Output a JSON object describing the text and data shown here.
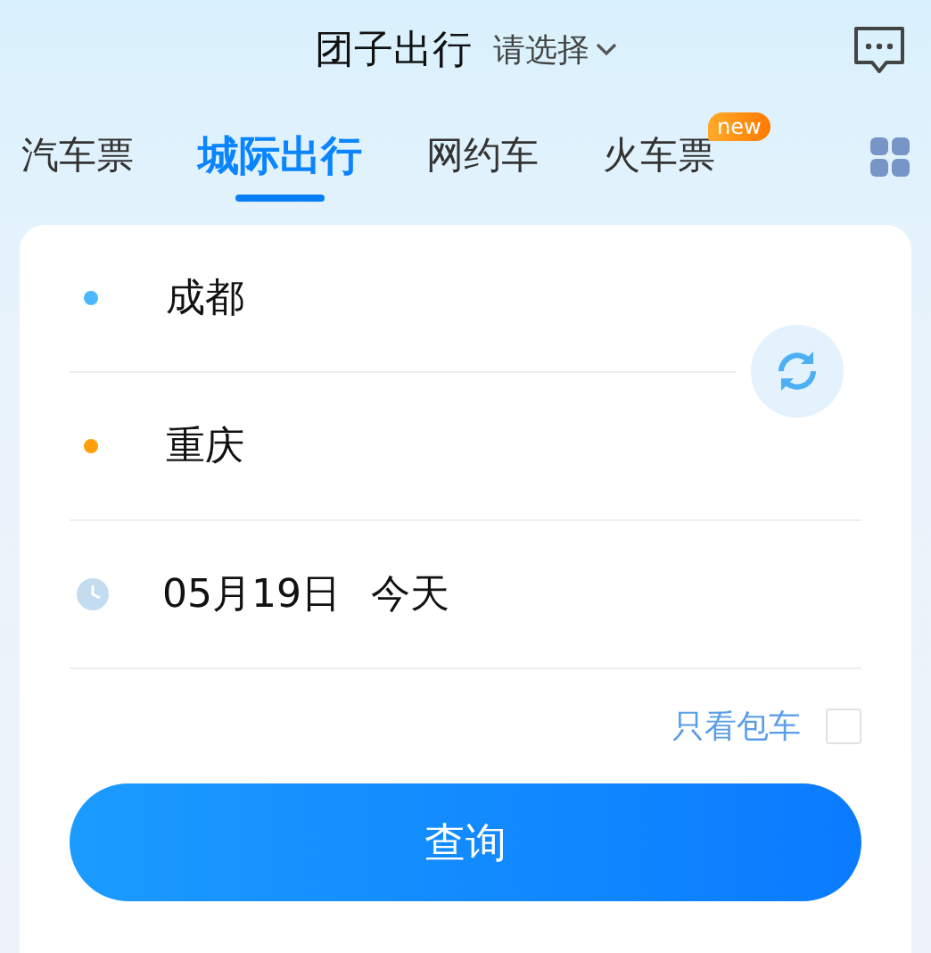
{
  "header": {
    "title": "团子出行",
    "selector": "请选择"
  },
  "tabs": [
    {
      "label": "汽车票",
      "selected": false
    },
    {
      "label": "城际出行",
      "selected": true
    },
    {
      "label": "网约车",
      "selected": false
    },
    {
      "label": "火车票",
      "selected": false,
      "badge": "new"
    }
  ],
  "stops": [
    {
      "city": "成都",
      "color": "#4db8ff"
    },
    {
      "city": "重庆",
      "color": "#ffa00a"
    }
  ],
  "date": {
    "value": "05月19日",
    "day": "今天"
  },
  "charter_only": {
    "label": "只看包车",
    "checked": false
  },
  "search_button": "查询"
}
